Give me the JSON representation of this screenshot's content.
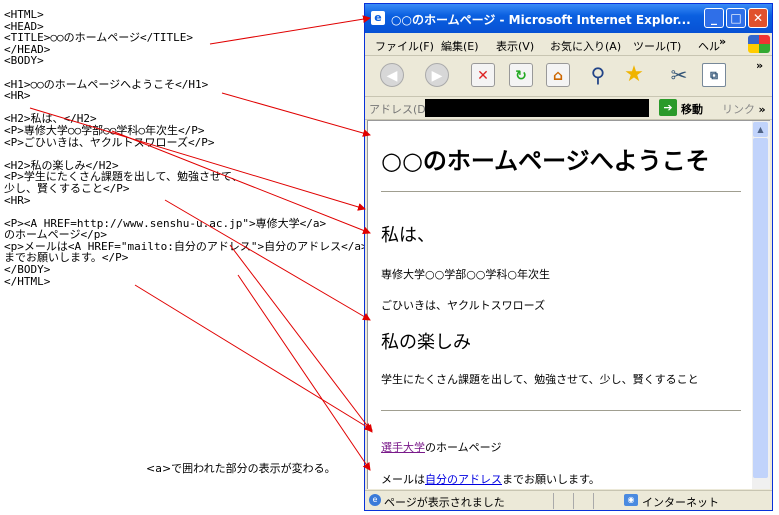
{
  "code_lines": [
    "<HTML>",
    "<HEAD>",
    "<TITLE>○○のホームページ</TITLE>",
    "</HEAD>",
    "<BODY>",
    "",
    "<H1>○○のホームページへようこそ</H1>",
    "<HR>",
    "",
    "<H2>私は、</H2>",
    "<P>専修大学○○学部○○学科○年次生</P>",
    "<P>ごひいきは、ヤクルトスワローズ</P>",
    "",
    "<H2>私の楽しみ</H2>",
    "<P>学生にたくさん課題を出して、勉強させて、",
    "少し、賢くすること</P>",
    "<HR>",
    "",
    "<P><A HREF=http://www.senshu-u.ac.jp\">専修大学</a>",
    "のホームページ</p>",
    "<p>メールは<A HREF=\"mailto:自分のアドレス\">自分のアドレス</a>",
    "までお願いします。</P>",
    "</BODY>",
    "</HTML>"
  ],
  "note": "<a>で囲われた部分の表示が変わる。",
  "browser": {
    "title": "○○のホームページ - Microsoft Internet Explor...",
    "menu": [
      "ファイル(F)",
      "編集(E)",
      "表示(V)",
      "お気に入り(A)",
      "ツール(T)",
      "ヘル"
    ],
    "address_label": "アドレス(D)",
    "go_label": "移動",
    "links_label": "リンク",
    "status_text": "ページが表示されました",
    "zone_text": "インターネット"
  },
  "page": {
    "h1": "○○のホームページへようこそ",
    "h2_1": "私は、",
    "p1": "専修大学○○学部○○学科○年次生",
    "p2": "ごひいきは、ヤクルトスワローズ",
    "h2_2": "私の楽しみ",
    "p3": "学生にたくさん課題を出して、勉強させて、少し、賢くすること",
    "link1": "選手大学",
    "link1_suffix": "のホームページ",
    "p5_prefix": "メールは",
    "link2": "自分のアドレス",
    "p5_suffix": "までお願いします。"
  }
}
